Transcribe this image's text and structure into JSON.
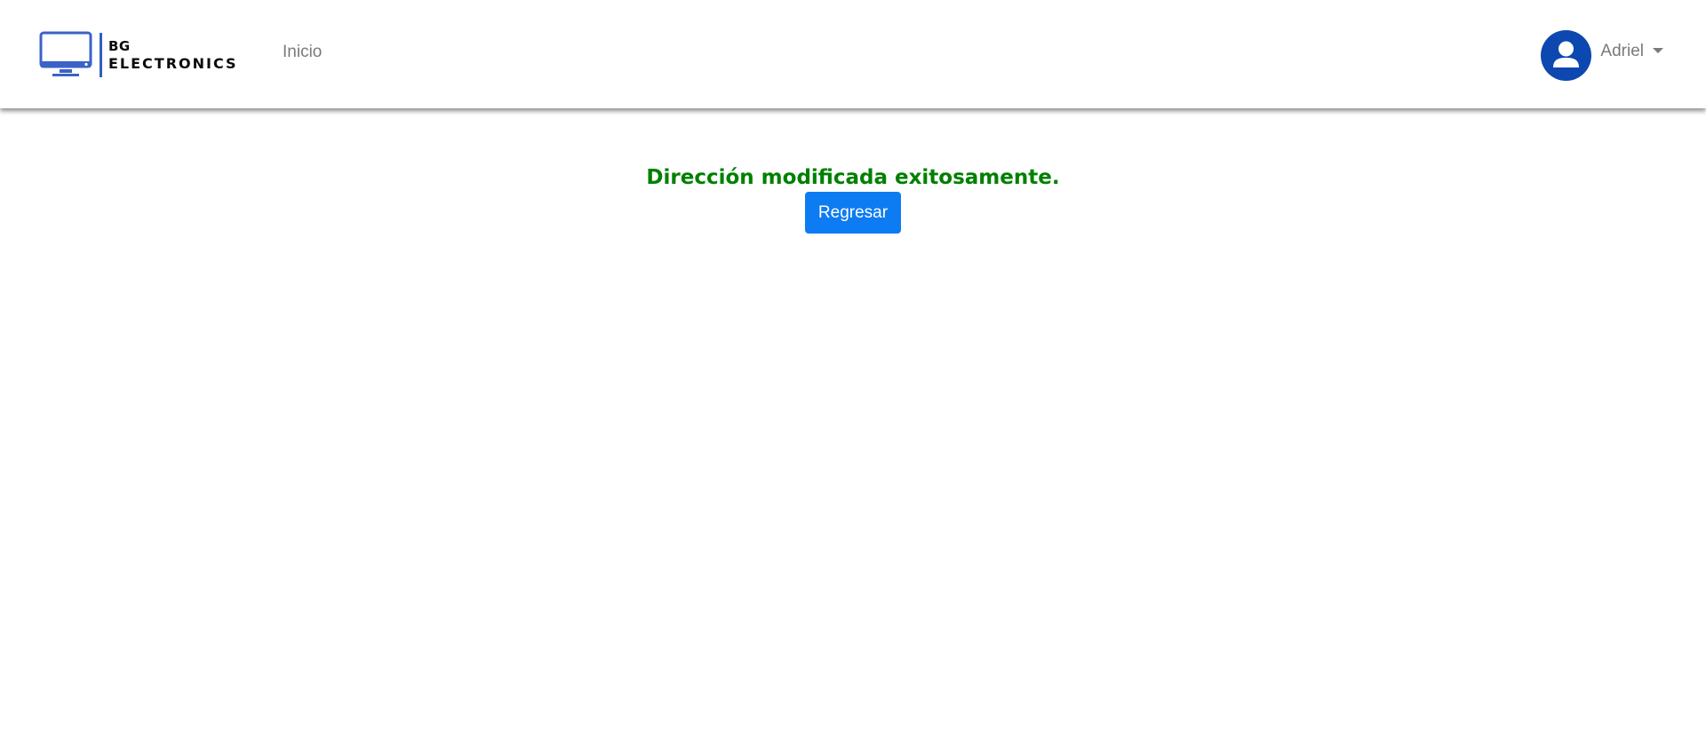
{
  "brand": {
    "line1": "BG",
    "line2": "ELECTRONICS",
    "icon": "monitor-icon",
    "accent_color": "#2f5fc4"
  },
  "nav": {
    "links": [
      {
        "label": "Inicio"
      }
    ]
  },
  "user": {
    "name": "Adriel",
    "avatar_icon": "user-icon",
    "avatar_color": "#0d47b0"
  },
  "main": {
    "message": "Dirección modificada exitosamente.",
    "message_color": "#008000",
    "back_button_label": "Regresar",
    "button_color": "#0d7cf2"
  }
}
